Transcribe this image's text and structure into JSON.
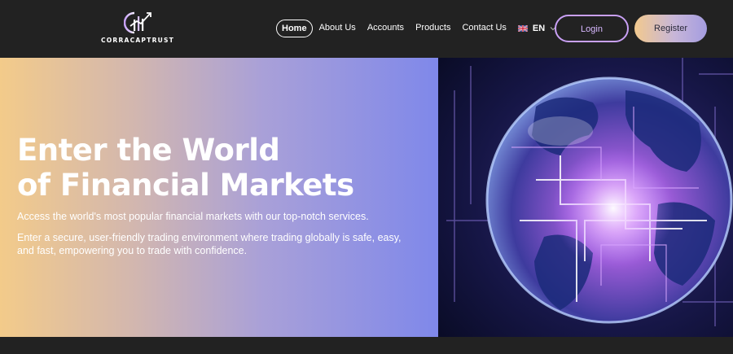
{
  "brand": {
    "name": "CORRACAPTRUST"
  },
  "nav": {
    "items": [
      {
        "label": "Home",
        "active": true
      },
      {
        "label": "About Us"
      },
      {
        "label": "Accounts"
      },
      {
        "label": "Products"
      },
      {
        "label": "Contact Us"
      }
    ],
    "language": {
      "code": "EN",
      "flag_icon": "uk-flag-icon"
    }
  },
  "auth": {
    "login_label": "Login",
    "register_label": "Register"
  },
  "hero": {
    "title_line1": "Enter the World",
    "title_line2": "of Financial Markets",
    "paragraph1": "Access the world's most popular financial markets with our top-notch services.",
    "paragraph2": "Enter a secure, user-friendly trading environment where trading globally is safe, easy, and fast, empowering you to trade with confidence."
  },
  "colors": {
    "header_bg": "#222222",
    "accent_purple": "#c9a0f5",
    "gradient_start": "#f3cb8a",
    "gradient_end": "#7f88ea"
  }
}
